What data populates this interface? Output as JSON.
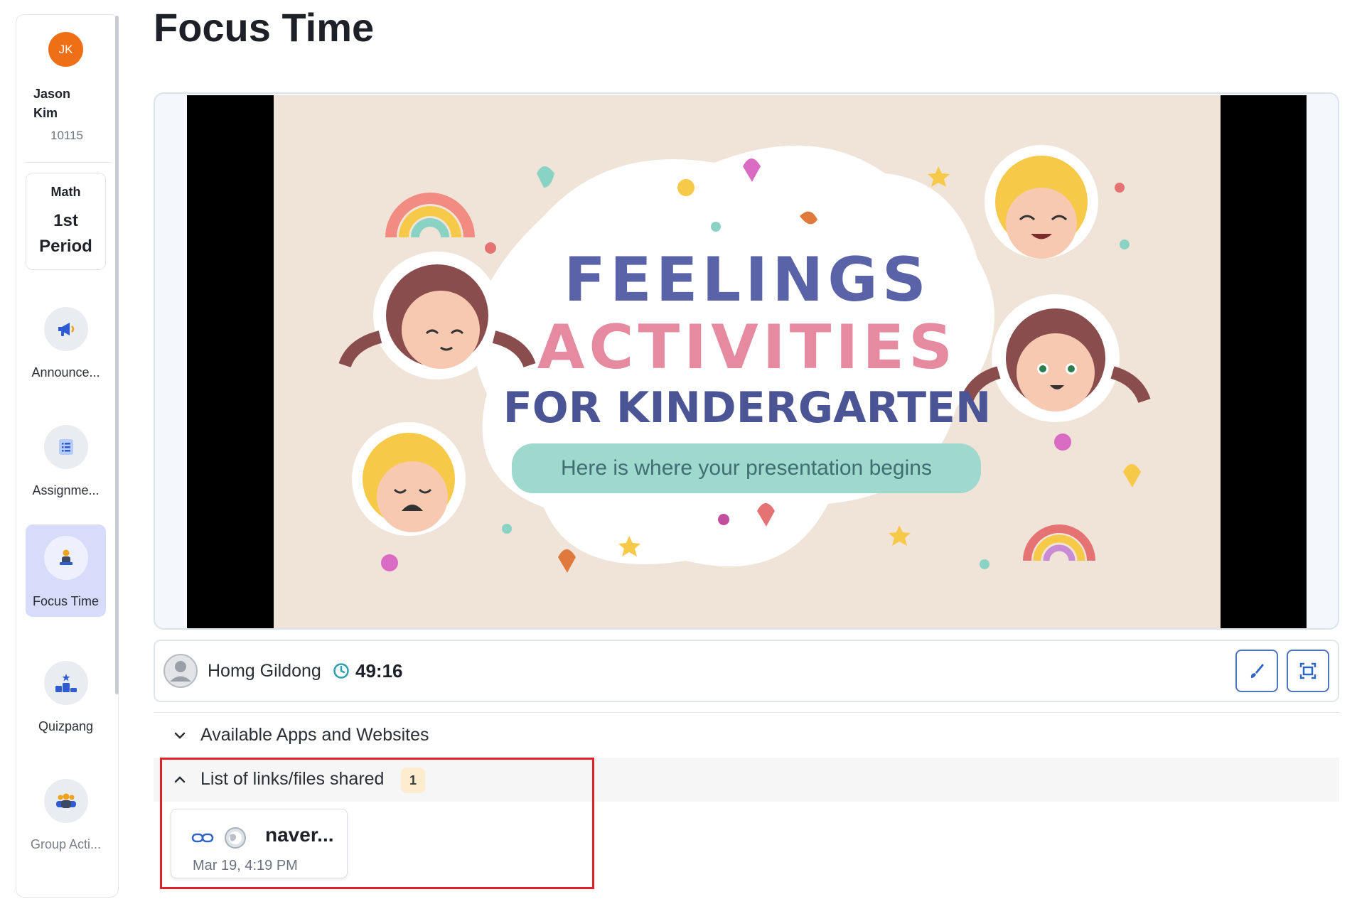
{
  "sidebar": {
    "user": {
      "initials": "JK",
      "name": "Jason Kim",
      "id": "10115"
    },
    "class": {
      "subject": "Math",
      "period": "1st Period"
    },
    "items": [
      {
        "label": "Announce...",
        "icon": "megaphone-icon"
      },
      {
        "label": "Assignme...",
        "icon": "list-icon"
      },
      {
        "label": "Focus Time",
        "icon": "student-at-desk-icon",
        "active": true
      },
      {
        "label": "Quizpang",
        "icon": "podium-icon"
      },
      {
        "label": "Group Acti...",
        "icon": "group-icon"
      }
    ]
  },
  "page": {
    "title": "Focus Time"
  },
  "slide": {
    "title_line1": "FEELINGS",
    "title_line2": "ACTIVITIES",
    "title_line3": "FOR KINDERGARTEN",
    "subtitle": "Here is where your presentation begins"
  },
  "presenter": {
    "name": "Homg Gildong",
    "timer": "49:16"
  },
  "toolbar": {
    "draw_icon": "brush-icon",
    "fullscreen_icon": "fullscreen-icon"
  },
  "sections": {
    "apps": {
      "label": "Available Apps and Websites",
      "expanded": false
    },
    "shared": {
      "label": "List of links/files shared",
      "count": "1",
      "expanded": true
    }
  },
  "shared_items": [
    {
      "title": "naver...",
      "time": "Mar 19, 4:19 PM"
    }
  ],
  "colors": {
    "accent": "#4d77b8",
    "highlight": "#e0202a",
    "avatar": "#ee6f16",
    "active_nav": "#d6dcf9"
  }
}
